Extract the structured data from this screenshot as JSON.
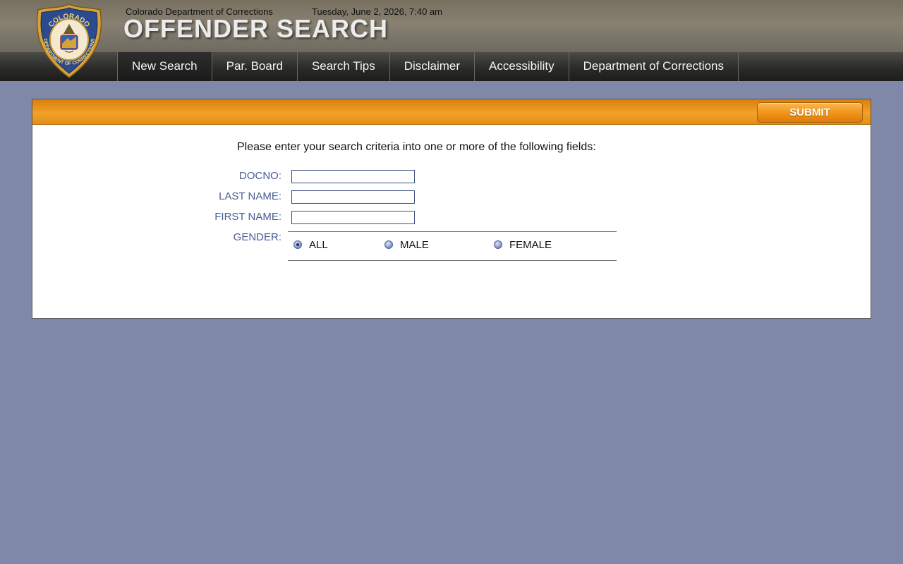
{
  "header": {
    "department": "Colorado Department of Corrections",
    "datetime": "Tuesday, June 2, 2026, 7:40 am",
    "title": "OFFENDER SEARCH",
    "logo_text": [
      "COLORADO",
      "DEPARTMENT OF CORRECTIONS"
    ]
  },
  "nav": {
    "items": [
      {
        "label": "New Search",
        "active": true
      },
      {
        "label": "Par. Board"
      },
      {
        "label": "Search Tips"
      },
      {
        "label": "Disclaimer"
      },
      {
        "label": "Accessibility"
      },
      {
        "label": "Department of Corrections"
      }
    ]
  },
  "form": {
    "submit_label": "SUBMIT",
    "instructions": "Please enter your search criteria into one or more of the following fields:",
    "docno_label": "DOCNO:",
    "docno_value": "",
    "last_name_label": "LAST NAME:",
    "last_name_value": "",
    "first_name_label": "FIRST NAME:",
    "first_name_value": "",
    "gender_label": "GENDER:",
    "gender_options": [
      "ALL",
      "MALE",
      "FEMALE"
    ],
    "gender_selected": "ALL"
  },
  "colors": {
    "page_background": "#7f88a9",
    "accent_orange": "#f0921a",
    "label_blue": "#4a5d94"
  }
}
